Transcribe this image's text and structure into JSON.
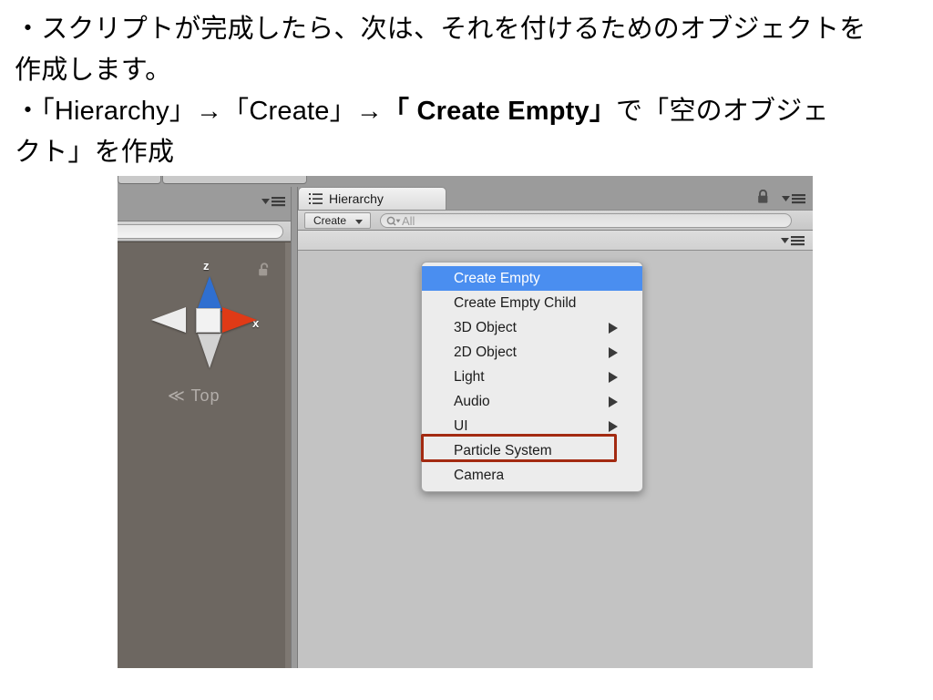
{
  "slide": {
    "line1": "・スクリプトが完成したら、次は、それを付けるためのオブジェクトを",
    "line2": "作成します。",
    "line3_pre": "・「Hierarchy」→「Create」→",
    "line3_bold": "「 Create Empty」",
    "line3_post": "で「空のオブジェ",
    "line4": "クト」を作成"
  },
  "scene_panel": {
    "gizmo": {
      "axis_z_label": "z",
      "axis_x_label": "x",
      "view_label": "≪ Top",
      "lock_icon": "lock-open-icon"
    },
    "menu_icon": "panel-menu-icon",
    "search_value": ""
  },
  "hierarchy": {
    "tab_label": "Hierarchy",
    "tab_icon": "hierarchy-list-icon",
    "lock_icon": "lock-closed-icon",
    "menu_icon": "panel-menu-icon",
    "toolbar": {
      "create_label": "Create",
      "create_caret_icon": "chevron-down-icon",
      "search_icon": "search-icon",
      "search_placeholder": "All",
      "search_value": ""
    },
    "sub_panel_menu_icon": "panel-menu-icon"
  },
  "context_menu": {
    "items": [
      {
        "label": "Create Empty",
        "selected": true,
        "submenu": false
      },
      {
        "label": "Create Empty Child",
        "selected": false,
        "submenu": false
      },
      {
        "label": "3D Object",
        "selected": false,
        "submenu": true
      },
      {
        "label": "2D Object",
        "selected": false,
        "submenu": true
      },
      {
        "label": "Light",
        "selected": false,
        "submenu": true
      },
      {
        "label": "Audio",
        "selected": false,
        "submenu": true
      },
      {
        "label": "UI",
        "selected": false,
        "submenu": true
      },
      {
        "label": "Particle System",
        "selected": false,
        "submenu": false
      },
      {
        "label": "Camera",
        "selected": false,
        "submenu": false
      }
    ]
  },
  "colors": {
    "selection_blue": "#4a8ef0",
    "annotation_red": "#a32a11",
    "axis_z_blue": "#2f6fd0",
    "axis_x_red": "#e03a16",
    "scene_bg": "#6d6761",
    "panel_bg": "#c3c3c3",
    "chrome_gray": "#9b9b9b"
  }
}
